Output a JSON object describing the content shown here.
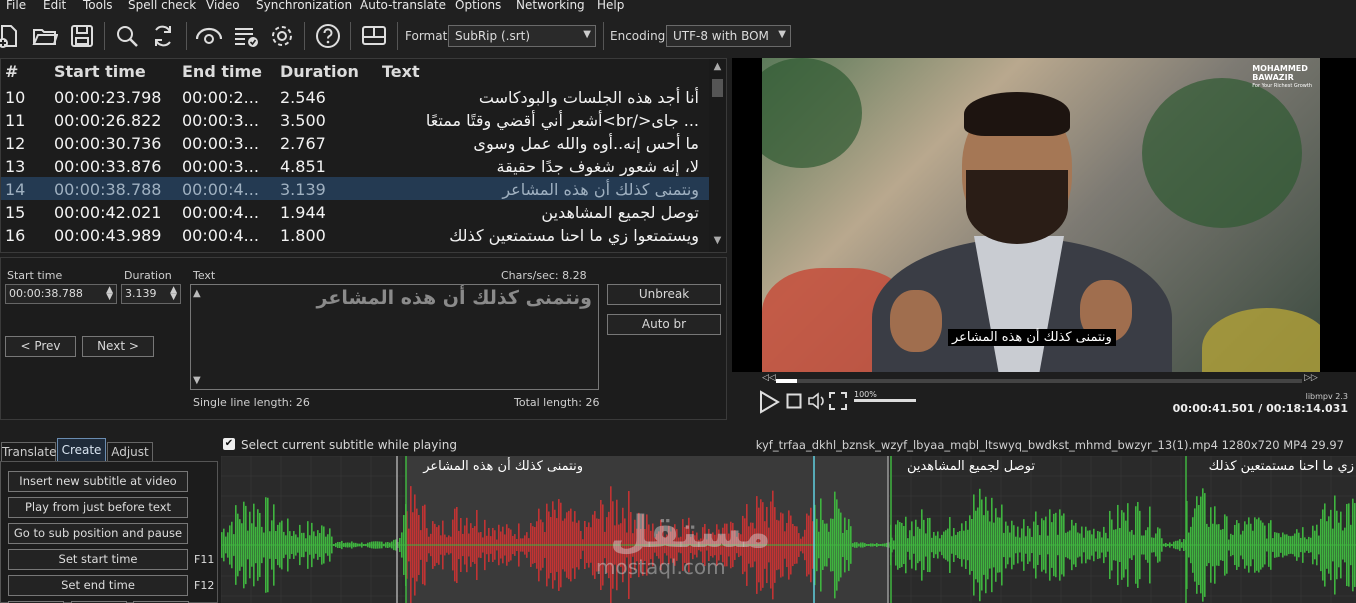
{
  "menu": [
    "File",
    "Edit",
    "Tools",
    "Spell check",
    "Video",
    "Synchronization",
    "Auto-translate",
    "Options",
    "Networking",
    "Help"
  ],
  "toolbar": {
    "icons": [
      "new-file-icon",
      "open-folder-icon",
      "save-icon",
      "search-icon",
      "replace-icon",
      "visual-sync-icon",
      "spell-check-icon",
      "settings-icon",
      "help-icon",
      "layout-icon"
    ],
    "format_label": "Format",
    "format_value": "SubRip (.srt)",
    "encoding_label": "Encoding",
    "encoding_value": "UTF-8 with BOM"
  },
  "grid": {
    "columns": [
      "#",
      "Start time",
      "End time",
      "Duration",
      "Text"
    ],
    "rows": [
      {
        "num": "10",
        "start": "00:00:23.798",
        "end": "00:00:2...",
        "duration": "2.546",
        "text": "أنا أجد هذه الجلسات والبودكاست"
      },
      {
        "num": "11",
        "start": "00:00:26.822",
        "end": "00:00:3...",
        "duration": "3.500",
        "text": "... جاى</br>أشعر أني أقضي وقتًا ممتعًا"
      },
      {
        "num": "12",
        "start": "00:00:30.736",
        "end": "00:00:3...",
        "duration": "2.767",
        "text": "ما أحس إنه..أوه والله عمل وسوى"
      },
      {
        "num": "13",
        "start": "00:00:33.876",
        "end": "00:00:3...",
        "duration": "4.851",
        "text": "لا، إنه شعور شغوف جدًا حقيقة"
      },
      {
        "num": "14",
        "start": "00:00:38.788",
        "end": "00:00:4...",
        "duration": "3.139",
        "text": "ونتمنى كذلك أن هذه المشاعر"
      },
      {
        "num": "15",
        "start": "00:00:42.021",
        "end": "00:00:4...",
        "duration": "1.944",
        "text": "توصل لجميع المشاهدين"
      },
      {
        "num": "16",
        "start": "00:00:43.989",
        "end": "00:00:4...",
        "duration": "1.800",
        "text": "ويستمتعوا زي ما احنا مستمتعين كذلك"
      }
    ],
    "selected_index": 4
  },
  "edit": {
    "start_label": "Start time",
    "start_value": "00:00:38.788",
    "duration_label": "Duration",
    "duration_value": "3.139",
    "text_label": "Text",
    "chars_sec": "Chars/sec: 8.28",
    "text_value": "ونتمنى كذلك أن هذه المشاعر",
    "unbreak_label": "Unbreak",
    "autobr_label": "Auto br",
    "prev_label": "< Prev",
    "next_label": "Next >",
    "single_line_length": "Single line length: 26",
    "total_length": "Total length: 26"
  },
  "video": {
    "logo_line1": "MOHAMMED",
    "logo_line2": "BAWAZIR",
    "logo_tagline": "For Your Richest Growth",
    "subtitle": "ونتمنى كذلك أن هذه المشاعر",
    "volume_label": "100%",
    "engine_label": "libmpv 2.3",
    "seek_fraction": 0.04,
    "volume_fraction": 1.0,
    "time": "00:00:41.501 / 00:18:14.031"
  },
  "bottom": {
    "tabs": [
      "Translate",
      "Create",
      "Adjust"
    ],
    "active_tab": "Create",
    "checkbox_label": "Select current subtitle while playing",
    "checkbox_checked": true,
    "file_info": "kyf_trfaa_dkhl_bznsk_wzyf_lbyaa_mqbl_ltswyq_bwdkst_mhmd_bwzyr_13(1).mp4 1280x720 MP4 29.97",
    "create_buttons": [
      {
        "label": "Insert new subtitle at video pos",
        "key": ""
      },
      {
        "label": "Play from just before text",
        "key": ""
      },
      {
        "label": "Go to sub position and pause",
        "key": ""
      },
      {
        "label": "Set start time",
        "key": "F11"
      },
      {
        "label": "Set end time",
        "key": "F12"
      }
    ],
    "wave_labels": [
      "ونتمنى كذلك أن هذه المشاعر",
      "توصل لجميع المشاهدين",
      "زي ما احنا مستمتعين كذلك"
    ],
    "watermark_arabic": "مستقل",
    "watermark_latin": "mostaql.com",
    "colors": {
      "wave_green": "#3fb43f",
      "wave_red": "#c23333",
      "accent": "#6a8cb0"
    }
  }
}
